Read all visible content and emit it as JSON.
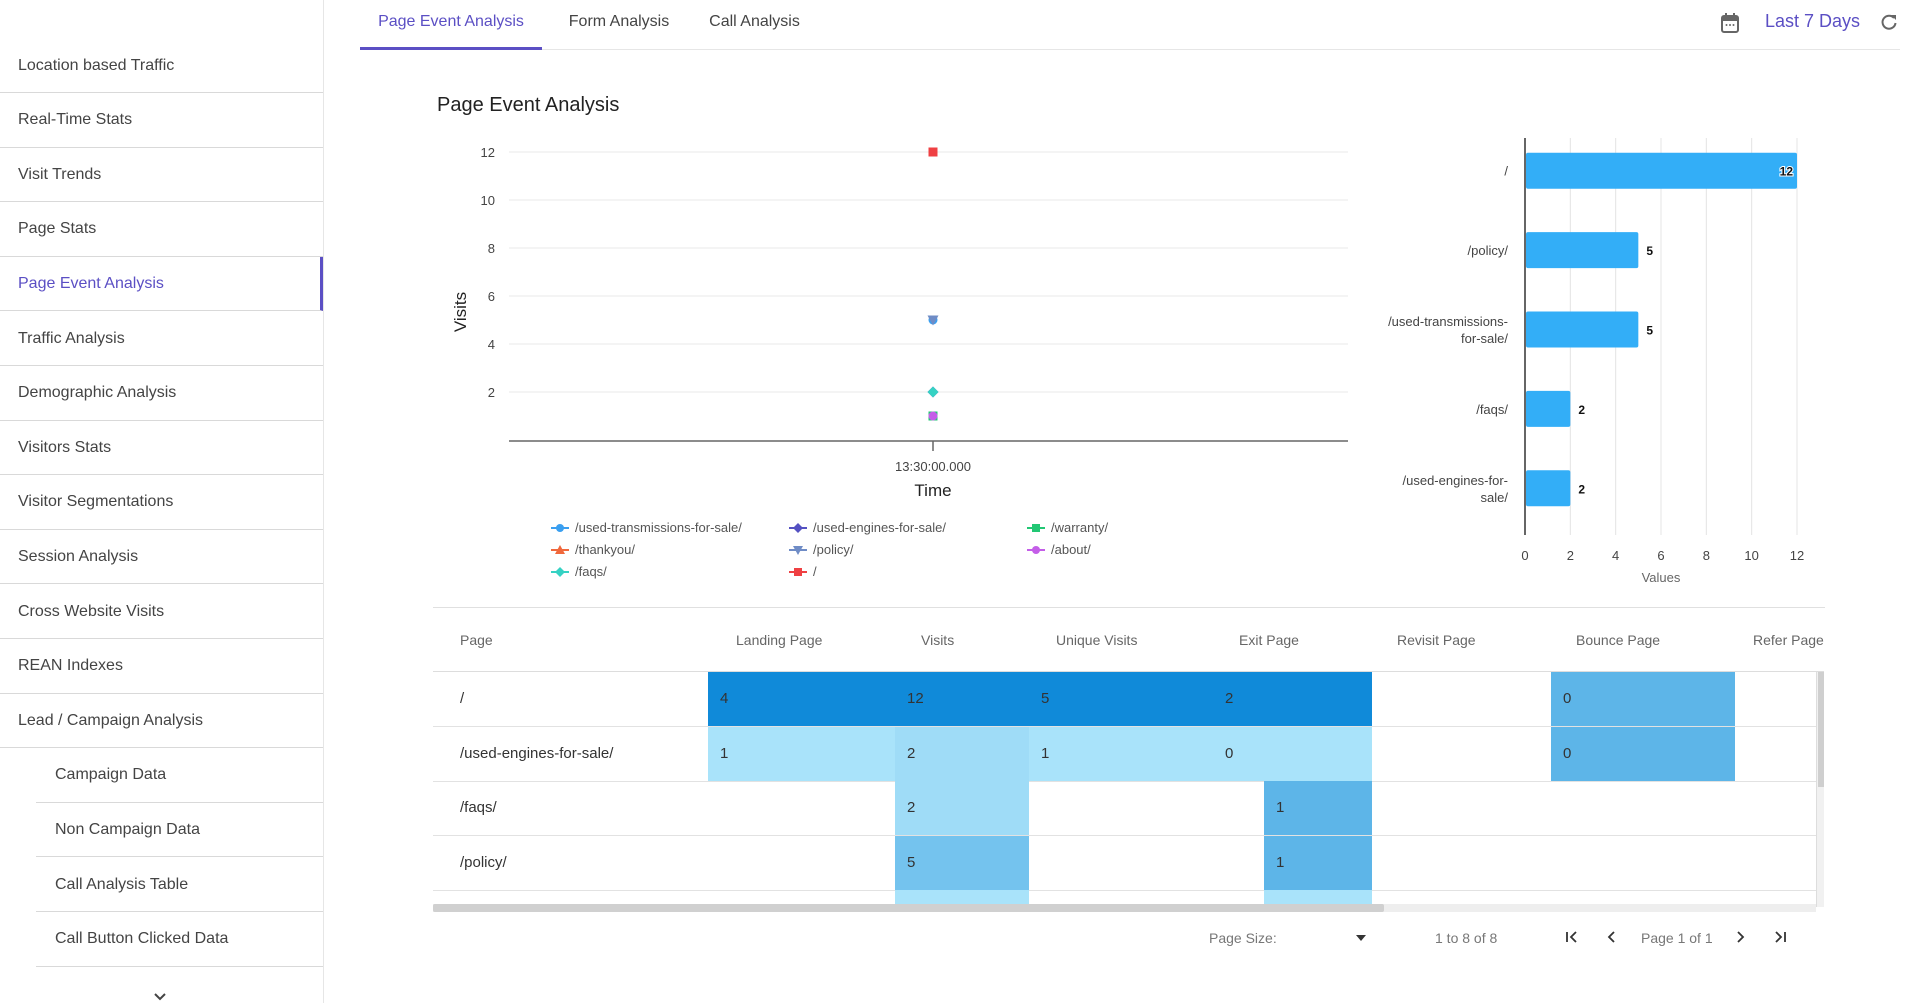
{
  "sidebar": {
    "items": [
      {
        "label": "Location based Traffic",
        "active": false,
        "sub": false
      },
      {
        "label": "Real-Time Stats",
        "active": false,
        "sub": false
      },
      {
        "label": "Visit Trends",
        "active": false,
        "sub": false
      },
      {
        "label": "Page Stats",
        "active": false,
        "sub": false
      },
      {
        "label": "Page Event Analysis",
        "active": true,
        "sub": false
      },
      {
        "label": "Traffic Analysis",
        "active": false,
        "sub": false
      },
      {
        "label": "Demographic Analysis",
        "active": false,
        "sub": false
      },
      {
        "label": "Visitors Stats",
        "active": false,
        "sub": false
      },
      {
        "label": "Visitor Segmentations",
        "active": false,
        "sub": false
      },
      {
        "label": "Session Analysis",
        "active": false,
        "sub": false
      },
      {
        "label": "Cross Website Visits",
        "active": false,
        "sub": false
      },
      {
        "label": "REAN Indexes",
        "active": false,
        "sub": false
      },
      {
        "label": "Lead / Campaign Analysis",
        "active": false,
        "sub": false
      },
      {
        "label": "Campaign Data",
        "active": false,
        "sub": true
      },
      {
        "label": "Non Campaign Data",
        "active": false,
        "sub": true
      },
      {
        "label": "Call Analysis Table",
        "active": false,
        "sub": true
      },
      {
        "label": "Call Button Clicked Data",
        "active": false,
        "sub": true
      }
    ],
    "more_icon": "chevron-down-icon"
  },
  "tabs": [
    {
      "label": "Page Event Analysis",
      "active": true
    },
    {
      "label": "Form Analysis",
      "active": false
    },
    {
      "label": "Call Analysis",
      "active": false
    }
  ],
  "header": {
    "date_icon": "calendar-icon",
    "date_range": "Last 7 Days",
    "refresh_icon": "refresh-icon"
  },
  "card": {
    "title": "Page Event Analysis"
  },
  "colors": {
    "accent": "#5b4fc4",
    "bar": "#33aef7",
    "heat_dark": "#108ad9",
    "heat_mid": "#5db5e8",
    "heat_mid2": "#74c3ee",
    "heat_light": "#9fdcf7",
    "heat_lighter": "#a9e3fa"
  },
  "chart_data": [
    {
      "type": "scatter",
      "title": "",
      "xlabel": "Time",
      "ylabel": "Visits",
      "x_ticks": [
        "13:30:00.000"
      ],
      "y_ticks": [
        2,
        4,
        6,
        8,
        10,
        12
      ],
      "ylim": [
        0,
        12
      ],
      "grid": true,
      "legend_position": "bottom",
      "series": [
        {
          "name": "/used-transmissions-for-sale/",
          "x": "13:30:00.000",
          "y": 5,
          "color": "#3a9ff0",
          "marker": "circle"
        },
        {
          "name": "/used-engines-for-sale/",
          "x": "13:30:00.000",
          "y": 2,
          "color": "#5451c2",
          "marker": "diamond"
        },
        {
          "name": "/warranty/",
          "x": "13:30:00.000",
          "y": 1,
          "color": "#22c774",
          "marker": "square"
        },
        {
          "name": "/thankyou/",
          "x": "13:30:00.000",
          "y": null,
          "color": "#f0683c",
          "marker": "triangle-up"
        },
        {
          "name": "/policy/",
          "x": "13:30:00.000",
          "y": 5,
          "color": "#6f8cc6",
          "marker": "triangle-down"
        },
        {
          "name": "/about/",
          "x": "13:30:00.000",
          "y": 1,
          "color": "#c45ee8",
          "marker": "circle"
        },
        {
          "name": "/faqs/",
          "x": "13:30:00.000",
          "y": 2,
          "color": "#35d2c3",
          "marker": "diamond"
        },
        {
          "name": "/",
          "x": "13:30:00.000",
          "y": 12,
          "color": "#ef4043",
          "marker": "square"
        }
      ]
    },
    {
      "type": "bar",
      "orientation": "horizontal",
      "title": "",
      "xlabel": "Values",
      "ylabel": "",
      "categories": [
        "/",
        "/policy/",
        "/used-transmissions-for-sale/",
        "/faqs/",
        "/used-engines-for-sale/"
      ],
      "category_lines": [
        [
          "/"
        ],
        [
          "/policy/"
        ],
        [
          "/used-transmissions-",
          "for-sale/"
        ],
        [
          "/faqs/"
        ],
        [
          "/used-engines-for-",
          "sale/"
        ]
      ],
      "values": [
        12,
        5,
        5,
        2,
        2
      ],
      "x_ticks": [
        0,
        2,
        4,
        6,
        8,
        10,
        12
      ],
      "xlim": [
        0,
        12
      ],
      "grid": true,
      "data_labels": true
    }
  ],
  "table": {
    "columns": [
      "Page",
      "Landing Page",
      "Visits",
      "Unique Visits",
      "Exit Page",
      "Revisit Page",
      "Bounce Page",
      "Refer Page"
    ],
    "rows": [
      {
        "cells": [
          "/",
          "4",
          "12",
          "5",
          "2",
          "",
          "0",
          ""
        ],
        "shade": [
          "",
          "dark",
          "dark",
          "dark",
          "dark",
          "",
          "mid",
          ""
        ]
      },
      {
        "cells": [
          "/used-engines-for-sale/",
          "1",
          "2",
          "1",
          "0",
          "",
          "0",
          ""
        ],
        "shade": [
          "",
          "lighter",
          "light",
          "lighter",
          "lighter",
          "",
          "mid",
          ""
        ]
      },
      {
        "cells": [
          "/faqs/",
          "",
          "2",
          "",
          "1",
          "",
          "",
          ""
        ],
        "shade": [
          "",
          "",
          "light",
          "",
          "mid",
          "",
          "",
          ""
        ]
      },
      {
        "cells": [
          "/policy/",
          "",
          "5",
          "",
          "1",
          "",
          "",
          ""
        ],
        "shade": [
          "",
          "",
          "mid2",
          "",
          "mid",
          "",
          "",
          ""
        ]
      },
      {
        "cells": [
          "",
          "",
          "",
          "",
          "",
          "",
          "",
          ""
        ],
        "shade": [
          "",
          "",
          "lighter",
          "",
          "lighter",
          "",
          "",
          ""
        ]
      }
    ]
  },
  "pagination": {
    "page_size_label": "Page Size:",
    "page_size_value": "",
    "range": "1 to 8 of 8",
    "page_label": "Page 1 of 1",
    "first_icon": "first-page-icon",
    "prev_icon": "prev-page-icon",
    "next_icon": "next-page-icon",
    "last_icon": "last-page-icon"
  }
}
